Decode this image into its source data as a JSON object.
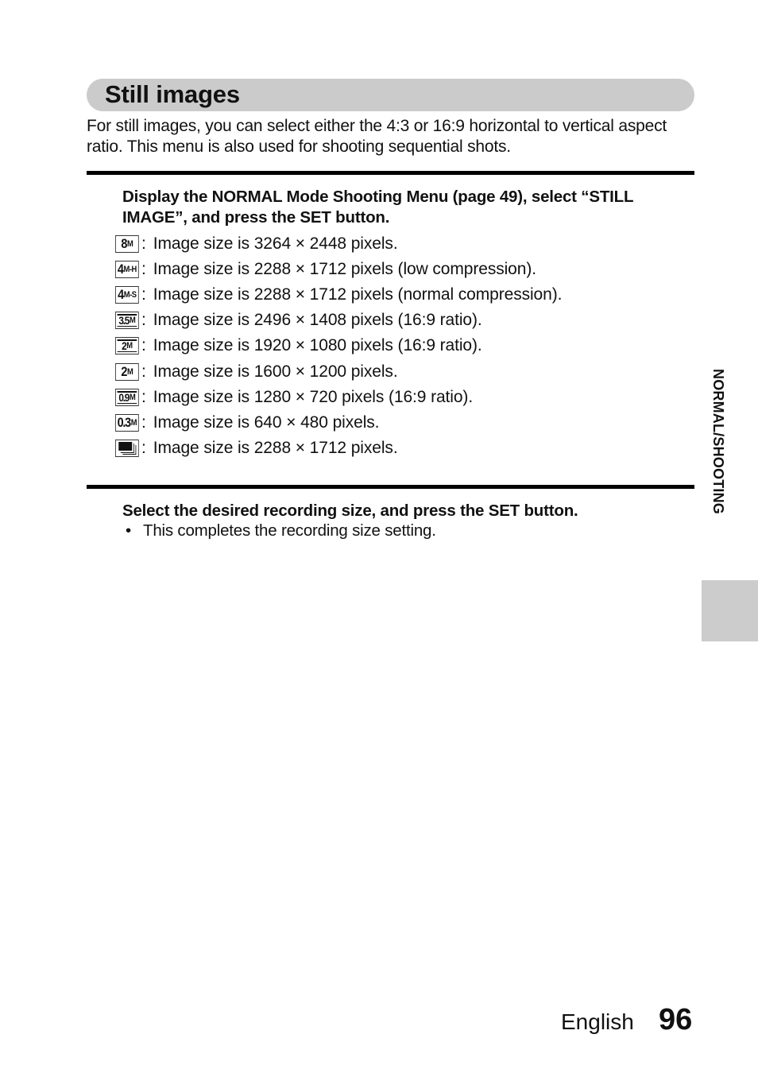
{
  "section": {
    "title": "Still images",
    "intro": "For still images, you can select either the 4:3 or 16:9 horizontal to vertical aspect ratio. This menu is also used for shooting sequential shots."
  },
  "steps": [
    {
      "instruction": "Display the NORMAL Mode Shooting Menu (page 49), select “STILL IMAGE”, and press the SET button.",
      "options": [
        {
          "icon": "8M",
          "icon_main": "8",
          "icon_sub": "M",
          "aspect": "4:3",
          "text": "Image size is 3264 × 2448 pixels."
        },
        {
          "icon": "4M-H",
          "icon_main": "4",
          "icon_sub": "M-H",
          "aspect": "4:3",
          "text": "Image size is 2288 × 1712 pixels (low compression)."
        },
        {
          "icon": "4M-S",
          "icon_main": "4",
          "icon_sub": "M-S",
          "aspect": "4:3",
          "text": "Image size is 2288 × 1712 pixels (normal compression)."
        },
        {
          "icon": "3.5M",
          "icon_main": "3.5",
          "icon_sub": "M",
          "aspect": "16:9",
          "text": "Image size is 2496 × 1408 pixels (16:9 ratio)."
        },
        {
          "icon": "2M (16:9)",
          "icon_main": "2",
          "icon_sub": "M",
          "aspect": "16:9",
          "text": "Image size is 1920 × 1080 pixels (16:9 ratio)."
        },
        {
          "icon": "2M",
          "icon_main": "2",
          "icon_sub": "M",
          "aspect": "4:3",
          "text": "Image size is 1600 × 1200 pixels."
        },
        {
          "icon": "0.9M",
          "icon_main": "0.9",
          "icon_sub": "M",
          "aspect": "16:9",
          "text": "Image size is 1280 × 720 pixels (16:9 ratio)."
        },
        {
          "icon": "0.3M",
          "icon_main": "0.3",
          "icon_sub": "M",
          "aspect": "4:3",
          "text": "Image size is 640 × 480 pixels."
        },
        {
          "icon": "sequential-shots",
          "icon_main": "",
          "icon_sub": "",
          "aspect": "4:3",
          "text": "Image size is 2288 × 1712 pixels."
        }
      ]
    },
    {
      "instruction": "Select the desired recording size, and press the SET button.",
      "bullets": [
        "This completes the recording size setting."
      ]
    }
  ],
  "sidebar": {
    "chapter_label": "NORMAL/SHOOTING"
  },
  "footer": {
    "language": "English",
    "page_number": "96"
  },
  "colors": {
    "title_bar": "#cbcbcb",
    "side_tab": "#cccccc",
    "rule": "#000000"
  }
}
